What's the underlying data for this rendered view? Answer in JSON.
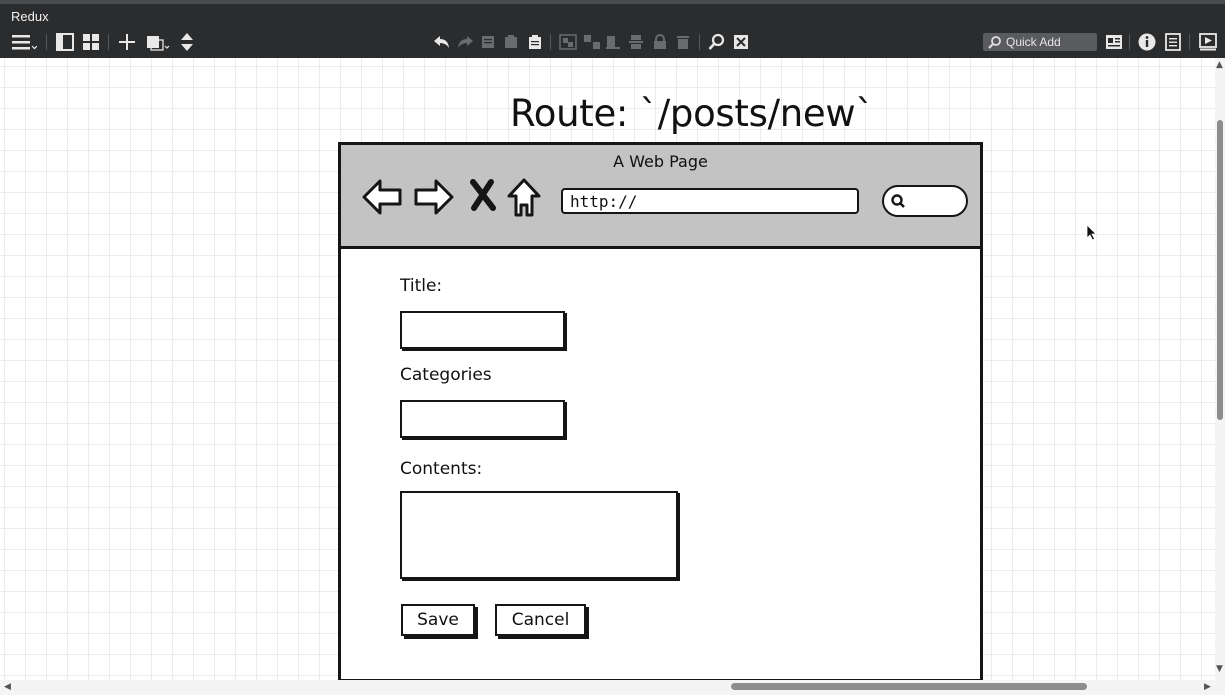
{
  "app": {
    "title": "Redux"
  },
  "toolbar": {
    "left_icons": [
      "menu-icon",
      "single-pane-icon",
      "grid-view-icon",
      "add-icon",
      "layer-icon",
      "move-updown-icon"
    ],
    "center_icons": [
      "undo-icon",
      "redo-icon",
      "copy-icon",
      "paste-icon",
      "clipboard-icon",
      "group-icon",
      "ungroup-icon",
      "align-icon",
      "distribute-icon",
      "lock-icon",
      "delete-icon",
      "find-icon",
      "clear-icon"
    ],
    "right_icons": [
      "contact-card-icon",
      "info-icon",
      "document-icon",
      "present-icon"
    ],
    "quick_add_label": "Quick Add"
  },
  "canvas": {
    "route_title": "Route: `/posts/new`",
    "browser": {
      "title": "A Web Page",
      "url": "http://",
      "nav_icons": [
        "back-arrow-icon",
        "forward-arrow-icon",
        "stop-icon",
        "home-icon",
        "search-icon"
      ],
      "form": {
        "title_label": "Title:",
        "categories_label": "Categories",
        "contents_label": "Contents:",
        "save_label": "Save",
        "cancel_label": "Cancel"
      }
    }
  },
  "colors": {
    "toolbar_bg": "#2b2c2e",
    "browser_bar_bg": "#c3c3c3",
    "sketch_stroke": "#151515",
    "grid_line": "#ececec"
  }
}
